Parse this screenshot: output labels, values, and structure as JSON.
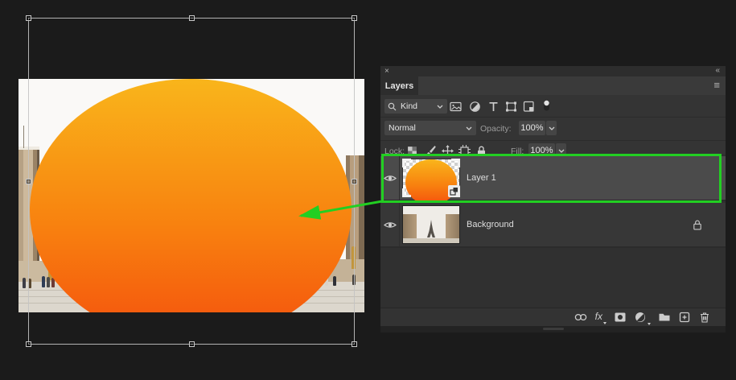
{
  "panel": {
    "tab_label": "Layers",
    "close_glyph": "×",
    "collapse_glyph": "«",
    "menu_glyph": "≡",
    "filter_row": {
      "search_label": "Kind",
      "filter_icon_names": [
        "pixel-layers-filter-icon",
        "adjustment-layers-filter-icon",
        "type-layers-filter-icon",
        "shape-layers-filter-icon",
        "smart-object-filter-icon",
        "layer-filter-toggle"
      ]
    },
    "blend_row": {
      "mode_value": "Normal",
      "opacity_label": "Opacity:",
      "opacity_value": "100%"
    },
    "lock_row": {
      "label": "Lock:",
      "icon_names": [
        "lock-transparency-icon",
        "lock-pixels-icon",
        "lock-position-icon",
        "lock-artboard-icon",
        "lock-all-icon"
      ],
      "fill_label": "Fill:",
      "fill_value": "100%"
    },
    "layers": [
      {
        "name": "Layer 1",
        "selected": true,
        "visible": true,
        "kind": "smart-object"
      },
      {
        "name": "Background",
        "selected": false,
        "visible": true,
        "locked": true
      }
    ],
    "footer": {
      "fx_label": "fx",
      "icon_names": [
        "link-layers-icon",
        "layer-style-icon",
        "layer-mask-icon",
        "adjustment-layer-icon",
        "new-group-icon",
        "new-layer-icon",
        "delete-layer-icon"
      ]
    }
  },
  "canvas_doc": {
    "shape": {
      "type": "ellipse",
      "gradient_top": "#F9B51B",
      "gradient_bottom": "#F4510E"
    },
    "transform_handle_count": 8
  },
  "annotation": {
    "highlight_color": "#22CF22"
  },
  "colors": {
    "workspace_bg": "#1B1B1B",
    "panel_bg": "#343434",
    "selected_row_bg": "#4B4B4B",
    "field_bg": "#454545"
  }
}
